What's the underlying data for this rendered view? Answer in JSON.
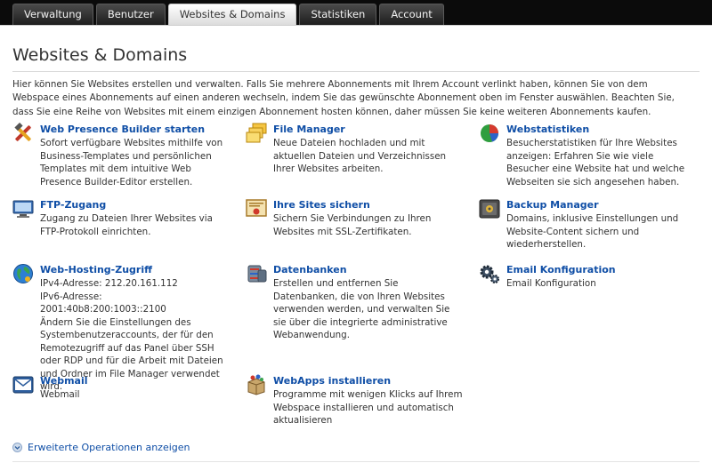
{
  "tabs": [
    "Verwaltung",
    "Benutzer",
    "Websites & Domains",
    "Statistiken",
    "Account"
  ],
  "page": {
    "title": "Websites & Domains",
    "description": "Hier können Sie Websites erstellen und verwalten. Falls Sie mehrere Abonnements mit Ihrem Account verlinkt haben, können Sie von dem Webspace eines Abonnements auf einen anderen wechseln, indem Sie das gewünschte Abonnement oben im Fenster auswählen. Beachten Sie, dass Sie eine Reihe von Websites mit einem einzigen Abonnement hosten können, daher müssen Sie keine weiteren Abonnements kaufen."
  },
  "tools": {
    "web_presence": {
      "name": "Web Presence Builder starten",
      "text": "Sofort verfügbare Websites mithilfe von Business-Templates und persönlichen Templates mit dem intuitive Web Presence Builder-Editor erstellen.",
      "icon": "wrench-hammer-icon"
    },
    "file_manager": {
      "name": "File Manager",
      "text": "Neue Dateien hochladen und mit aktuellen Dateien und Verzeichnissen Ihrer Websites arbeiten.",
      "icon": "folders-icon"
    },
    "webstatistiken": {
      "name": "Webstatistiken",
      "text": "Besucherstatistiken für Ihre Websites anzeigen: Erfahren Sie wie viele Besucher eine Website hat und welche Webseiten sie sich angesehen haben.",
      "icon": "pie-chart-icon"
    },
    "ftp": {
      "name": "FTP-Zugang",
      "text": "Zugang zu Dateien Ihrer Websites via FTP-Protokoll einrichten.",
      "icon": "ftp-monitor-icon"
    },
    "ssl": {
      "name": "Ihre Sites sichern",
      "text": "Sichern Sie Verbindungen zu Ihren Websites mit SSL-Zertifikaten.",
      "icon": "certificate-icon"
    },
    "backup": {
      "name": "Backup Manager",
      "text": "Domains, inklusive Einstellungen und Website-Content sichern und wiederherstellen.",
      "icon": "backup-safe-icon"
    },
    "hosting": {
      "name": "Web-Hosting-Zugriff",
      "ipv4": "IPv4-Adresse: 212.20.161.112",
      "ipv6": "IPv6-Adresse: 2001:40b8:200:1003::2100",
      "text": "Ändern Sie die Einstellungen des Systembenutzeraccounts, der für den Remotezugriff auf das Panel über SSH oder RDP und für die Arbeit mit Dateien und Ordner im File Manager verwendet wird.",
      "icon": "globe-icon"
    },
    "datenbanken": {
      "name": "Datenbanken",
      "text": "Erstellen und entfernen Sie Datenbanken, die von Ihren Websites verwenden werden, und verwalten Sie sie über die integrierte administrative Webanwendung.",
      "icon": "database-icon"
    },
    "email_config": {
      "name": "Email Konfiguration",
      "text": "Email Konfiguration",
      "icon": "gears-icon"
    },
    "webmail": {
      "name": "Webmail",
      "text": "Webmail",
      "icon": "envelope-icon"
    },
    "webapps": {
      "name": "WebApps installieren",
      "text": "Programme mit wenigen Klicks auf Ihrem Webspace installieren und automatisch aktualisieren",
      "icon": "app-box-icon"
    }
  },
  "advanced": {
    "label": "Erweiterte Operationen anzeigen",
    "icon": "expand-arrow-icon"
  }
}
